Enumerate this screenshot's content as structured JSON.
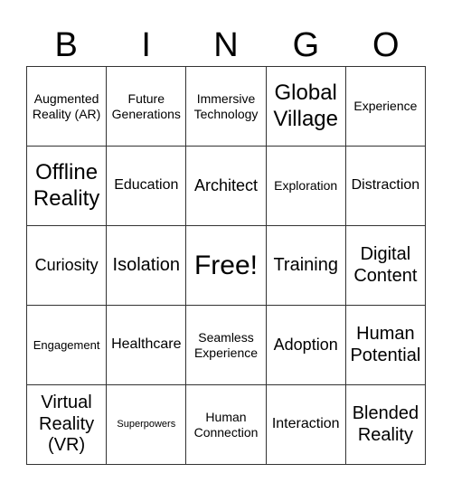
{
  "header": [
    "B",
    "I",
    "N",
    "G",
    "O"
  ],
  "cells": [
    [
      "Augmented Reality (AR)",
      "Future Generations",
      "Immersive Technology",
      "Global Village",
      "Experience"
    ],
    [
      "Offline Reality",
      "Education",
      "Architect",
      "Exploration",
      "Distraction"
    ],
    [
      "Curiosity",
      "Isolation",
      "Free!",
      "Training",
      "Digital Content"
    ],
    [
      "Engagement",
      "Healthcare",
      "Seamless Experience",
      "Adoption",
      "Human Potential"
    ],
    [
      "Virtual Reality (VR)",
      "Superpowers",
      "Human Connection",
      "Interaction",
      "Blended Reality"
    ]
  ]
}
